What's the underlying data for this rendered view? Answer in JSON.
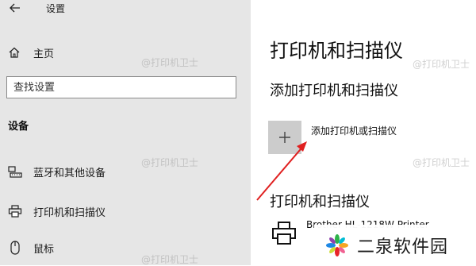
{
  "window": {
    "title": "设置"
  },
  "sidebar": {
    "home_label": "主页",
    "search_placeholder": "查找设置",
    "section_heading": "设备",
    "items": [
      {
        "label": "蓝牙和其他设备",
        "icon": "bluetooth-devices-icon"
      },
      {
        "label": "打印机和扫描仪",
        "icon": "printer-icon"
      },
      {
        "label": "鼠标",
        "icon": "mouse-icon"
      }
    ]
  },
  "main": {
    "page_title": "打印机和扫描仪",
    "add_section_title": "添加打印机和扫描仪",
    "add_button_label": "添加打印机或扫描仪",
    "printers_section_title": "打印机和扫描仪",
    "printer_name": "Brother HL-1218W Printer"
  },
  "watermarks": [
    "@打印机卫士",
    "@打印机卫士",
    "@打印机卫士",
    "@打印机卫士",
    "@打印机卫士"
  ],
  "brand": {
    "text": "二泉软件园"
  },
  "colors": {
    "sidebar_bg": "#e6e6e6",
    "add_tile_bg": "#cccccc",
    "annotation_arrow": "#e02020"
  }
}
